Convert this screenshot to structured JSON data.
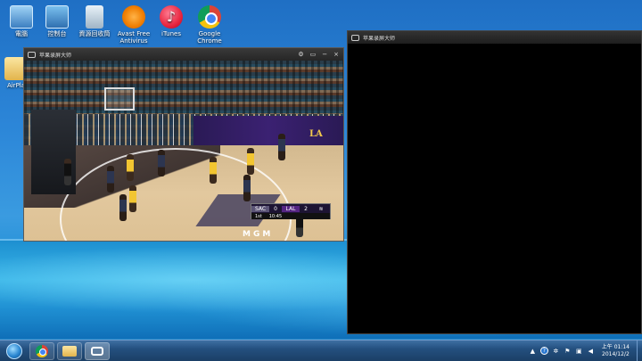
{
  "desktop": {
    "icons": [
      {
        "label": "電腦",
        "icon": "computer-icon"
      },
      {
        "label": "控制台",
        "icon": "control-panel-icon"
      },
      {
        "label": "資源回收筒",
        "icon": "recycle-bin-icon"
      },
      {
        "label": "Avast Free Antivirus",
        "icon": "avast-icon"
      },
      {
        "label": "iTunes",
        "icon": "itunes-icon"
      },
      {
        "label": "Google Chrome",
        "icon": "chrome-icon"
      },
      {
        "label": "AirPla",
        "icon": "folder-icon"
      }
    ]
  },
  "window_video": {
    "title": "苹果录屏大师",
    "controls": [
      "⚙",
      "▭",
      "−",
      "×"
    ]
  },
  "window_black": {
    "title": "苹果录屏大师"
  },
  "video": {
    "court_text": "MGM",
    "led_text": "LA",
    "scorebug": {
      "team1": "SAC",
      "score1": "0",
      "team2": "LAL",
      "score2": "2",
      "period": "1st",
      "clock": "10:45"
    }
  },
  "taskbar": {
    "tray_time": "上午 01:14",
    "tray_date": "2014/12/2"
  }
}
